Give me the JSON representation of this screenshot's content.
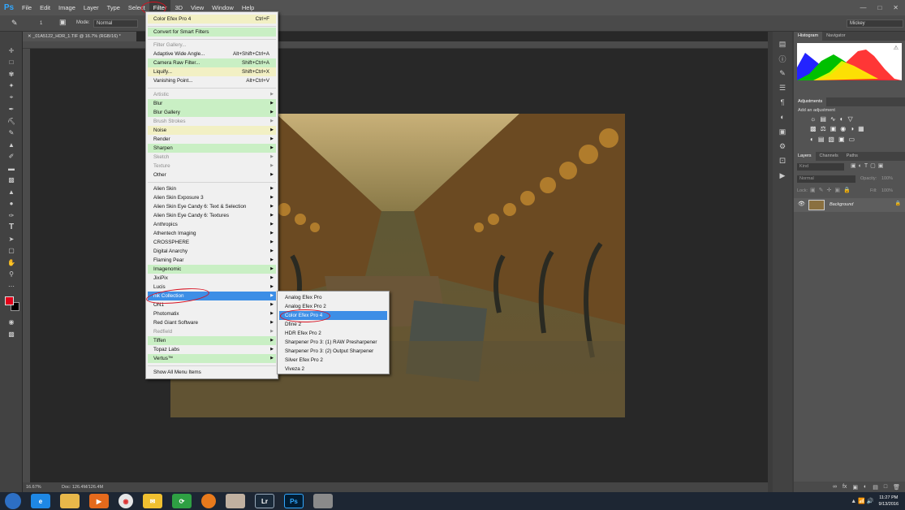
{
  "app": {
    "logo": "Ps"
  },
  "menubar": {
    "items": [
      "File",
      "Edit",
      "Image",
      "Layer",
      "Type",
      "Select",
      "Filter",
      "3D",
      "View",
      "Window",
      "Help"
    ],
    "active": "Filter"
  },
  "options_bar": {
    "mode_label": "Mode:",
    "mode_value": "Normal",
    "brush_size": "1",
    "workspace": "Mickey"
  },
  "document": {
    "tab_title": "_01A5122_HDR_1.TIF @ 16.7% (RGB/16) *",
    "zoom": "16.67%",
    "doc_size": "Doc: 126.4M/126.4M"
  },
  "filter_menu": {
    "last_filter": {
      "label": "Color Efex Pro 4",
      "shortcut": "Ctrl+F"
    },
    "convert": "Convert for Smart Filters",
    "gallery": "Filter Gallery...",
    "adaptive": {
      "label": "Adaptive Wide Angle...",
      "shortcut": "Alt+Shift+Ctrl+A"
    },
    "camera_raw": {
      "label": "Camera Raw Filter...",
      "shortcut": "Shift+Ctrl+A"
    },
    "liquify": {
      "label": "Liquify...",
      "shortcut": "Shift+Ctrl+X"
    },
    "vanishing": {
      "label": "Vanishing Point...",
      "shortcut": "Alt+Ctrl+V"
    },
    "groups": [
      "Artistic",
      "Blur",
      "Blur Gallery",
      "Brush Strokes",
      "Noise",
      "Render",
      "Sharpen",
      "Sketch",
      "Texture",
      "Other"
    ],
    "plugins": [
      "Alien Skin",
      "Alien Skin Exposure 3",
      "Alien Skin Eye Candy 6: Text & Selection",
      "Alien Skin Eye Candy 6: Textures",
      "Anthropics",
      "Athentech Imaging",
      "CROSSPHERE",
      "Digital Anarchy",
      "Flaming Pear",
      "Imagenomic",
      "JixiPix",
      "Lucis",
      "Nik Collection",
      "ON1",
      "Photomatix",
      "Red Giant Software",
      "Redfield",
      "Tiffen",
      "Topaz Labs",
      "Vertus™"
    ],
    "plugins_display": [
      "Alien Skin",
      "Alien Skin Exposure 3",
      "Alien Skin Eye Candy 6: Text & Selection",
      "Alien Skin Eye Candy 6: Textures",
      "Anthropics",
      "Athentech Imaging",
      "CROSSPHERE",
      "Digital Anarchy",
      "Flaming Pear",
      "Imagenomic",
      "JixiPix",
      "Lucis",
      "nik Collection",
      "ON1",
      "Photomatix",
      "Red Giant Software",
      "Redfield",
      "Tiffen",
      "Topaz Labs",
      "Vertus™"
    ],
    "show_all": "Show All Menu Items"
  },
  "nik_submenu": {
    "items": [
      "Analog Efex Pro",
      "Analog Efex Pro 2",
      "Color Efex Pro 4",
      "Dfine 2",
      "HDR Efex Pro 2",
      "Sharpener Pro 3: (1) RAW Presharpener",
      "Sharpener Pro 3: (2) Output Sharpener",
      "Silver Efex Pro 2",
      "Viveza 2"
    ],
    "highlighted": "Color Efex Pro 4"
  },
  "panels": {
    "top_tabs": [
      "Histogram",
      "Navigator"
    ],
    "adjust_tab": "Adjustments",
    "adjust_hint": "Add an adjustment",
    "layer_tabs": [
      "Layers",
      "Channels",
      "Paths"
    ],
    "kind": "Kind",
    "blend": "Normal",
    "opacity_label": "Opacity:",
    "opacity": "100%",
    "lock_label": "Lock:",
    "fill_label": "Fill:",
    "fill": "100%",
    "layer_name": "Background"
  },
  "taskbar": {
    "time": "11:27 PM",
    "date": "9/13/2016",
    "apps": [
      "Lr",
      "Ps"
    ]
  }
}
